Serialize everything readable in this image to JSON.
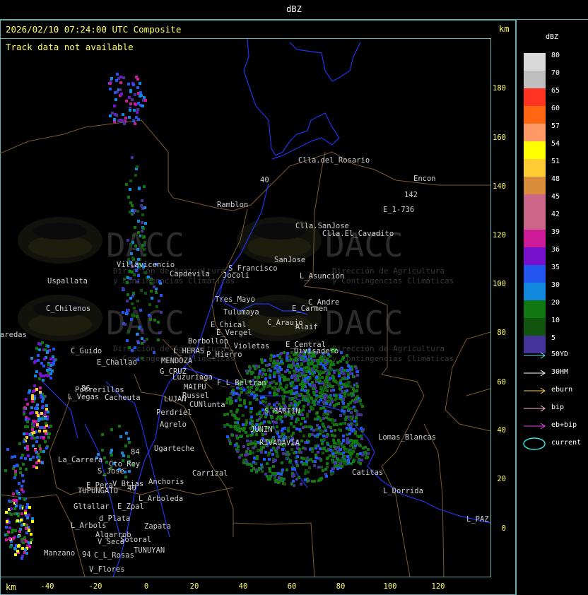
{
  "header": {
    "title": "dBZ",
    "timestamp": "2026/02/10 07:24:00 UTC Composite",
    "track_status": "Track data not available",
    "km_label_top": "km",
    "km_label_bottom": "km"
  },
  "axes": {
    "x_ticks": [
      "-40",
      "-20",
      "0",
      "20",
      "40",
      "60",
      "80",
      "100",
      "120"
    ],
    "y_ticks": [
      "180",
      "160",
      "140",
      "120",
      "100",
      "80",
      "60",
      "40",
      "20",
      "0"
    ]
  },
  "legend": {
    "title": "dBZ",
    "levels": [
      {
        "label": "80",
        "color": "#d9d9d9"
      },
      {
        "label": "70",
        "color": "#bfbfbf"
      },
      {
        "label": "65",
        "color": "#ff3322"
      },
      {
        "label": "60",
        "color": "#ff6611"
      },
      {
        "label": "57",
        "color": "#ff9966"
      },
      {
        "label": "54",
        "color": "#ffff00"
      },
      {
        "label": "51",
        "color": "#ffcc33"
      },
      {
        "label": "48",
        "color": "#d98c3a"
      },
      {
        "label": "45",
        "color": "#cc6688"
      },
      {
        "label": "42",
        "color": "#cc6688"
      },
      {
        "label": "39",
        "color": "#cc1a99"
      },
      {
        "label": "36",
        "color": "#7711cc"
      },
      {
        "label": "35",
        "color": "#2255ee"
      },
      {
        "label": "30",
        "color": "#1188dd"
      },
      {
        "label": "20",
        "color": "#117711"
      },
      {
        "label": "10",
        "color": "#115511"
      },
      {
        "label": "5",
        "color": "#443399"
      }
    ],
    "tracks": [
      {
        "label": "50YD",
        "color": "#66dddd"
      },
      {
        "label": "30HM",
        "color": "#ffffff"
      },
      {
        "label": "eburn",
        "color": "#ffcc66"
      },
      {
        "label": "bip",
        "color": "#ffbbdd"
      },
      {
        "label": "eb+bip",
        "color": "#ee44ee"
      }
    ],
    "current_label": "current",
    "current_color": "#33dddd"
  },
  "watermark": {
    "logo_text": "DACC",
    "line1": "Dirección de Agricultura",
    "line2": "y Contingencias Climáticas"
  },
  "places": [
    {
      "name": "Clla.del_Rosario"
    },
    {
      "name": "Encon"
    },
    {
      "name": "Ramblon"
    },
    {
      "name": "142"
    },
    {
      "name": "E_1-736"
    },
    {
      "name": "Clla.SanJose"
    },
    {
      "name": "Clla.El_Cavadito"
    },
    {
      "name": "Villavicencio"
    },
    {
      "name": "Capdevila"
    },
    {
      "name": "S_Francisco"
    },
    {
      "name": "Jocoli"
    },
    {
      "name": "SanJose"
    },
    {
      "name": "L_Asuncion"
    },
    {
      "name": "Uspallata"
    },
    {
      "name": "Tres_Mayo"
    },
    {
      "name": "C_Andre"
    },
    {
      "name": "C_Chilenos"
    },
    {
      "name": "Tulumaya"
    },
    {
      "name": "E_Carmen"
    },
    {
      "name": "aredas"
    },
    {
      "name": "E_Chical"
    },
    {
      "name": "C_Araujo"
    },
    {
      "name": "Alaif"
    },
    {
      "name": "E_Vergel"
    },
    {
      "name": "Borbollon"
    },
    {
      "name": "E_Central"
    },
    {
      "name": "C_Guido"
    },
    {
      "name": "L_HERAS"
    },
    {
      "name": "L_Violetas"
    },
    {
      "name": "Divisadero"
    },
    {
      "name": "P_Hierro"
    },
    {
      "name": "E_Challao"
    },
    {
      "name": "MENDOZA"
    },
    {
      "name": "G_CRUZ"
    },
    {
      "name": "Luzuriaga"
    },
    {
      "name": "F_L_Beltran"
    },
    {
      "name": "Potrerillos"
    },
    {
      "name": "MAIPU"
    },
    {
      "name": "Russel"
    },
    {
      "name": "L_Vegas"
    },
    {
      "name": "Cacheuta"
    },
    {
      "name": "LUJAN"
    },
    {
      "name": "CUNlunta"
    },
    {
      "name": "Perdriel"
    },
    {
      "name": "S_MARTIN"
    },
    {
      "name": "Agrelo"
    },
    {
      "name": "JUNIN"
    },
    {
      "name": "Ugarteche"
    },
    {
      "name": "RIVADAVIA"
    },
    {
      "name": "Lomas_Blancas"
    },
    {
      "name": "La_Carrera"
    },
    {
      "name": "Cto_Rey"
    },
    {
      "name": "S_Jose"
    },
    {
      "name": "Carrizal"
    },
    {
      "name": "Catitas"
    },
    {
      "name": "Anchoris"
    },
    {
      "name": "V_Btias"
    },
    {
      "name": "E_Pera"
    },
    {
      "name": "TUPUNGATO"
    },
    {
      "name": "L_Arboleda"
    },
    {
      "name": "L_Dorrida"
    },
    {
      "name": "Gltallar"
    },
    {
      "name": "E_Zpal"
    },
    {
      "name": "d_Plata"
    },
    {
      "name": "L_Arbols"
    },
    {
      "name": "Zapata"
    },
    {
      "name": "L_PAZ"
    },
    {
      "name": "Algarrob"
    },
    {
      "name": "V_Seco"
    },
    {
      "name": "Sotoral"
    },
    {
      "name": "TUNUYAN"
    },
    {
      "name": "Manzano"
    },
    {
      "name": "C_L_Rosas"
    },
    {
      "name": "V_Flores"
    },
    {
      "name": "40"
    },
    {
      "name": "86"
    },
    {
      "name": "84"
    },
    {
      "name": "94"
    },
    {
      "name": "40"
    }
  ]
}
